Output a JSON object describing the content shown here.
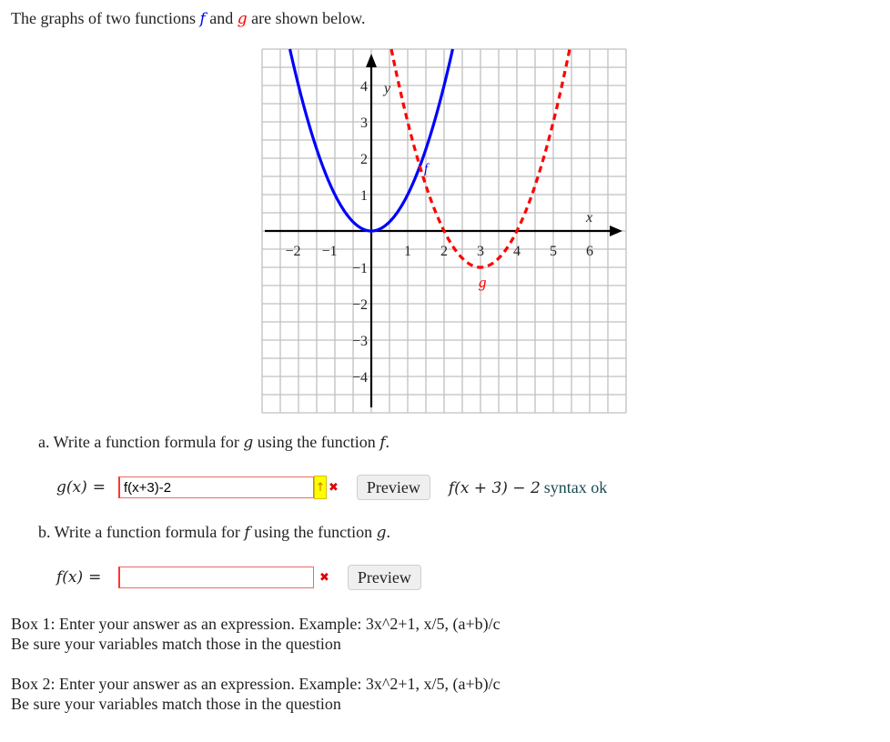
{
  "intro": {
    "before": "The graphs of two functions ",
    "f_symbol": "f",
    "middle": " and ",
    "g_symbol": "g",
    "after": " are shown below."
  },
  "colors": {
    "f": "#0000ff",
    "g": "#ff0000",
    "grid": "#c0c0c0",
    "axis": "#000000",
    "input_border": "#e86b6b",
    "syntax_ok": "#1a4a50"
  },
  "chart_data": {
    "type": "line",
    "title": "",
    "xlabel": "x",
    "ylabel": "y",
    "xlim": [
      -3,
      7
    ],
    "ylim": [
      -5,
      5
    ],
    "grid": true,
    "grid_minor_step": 0.5,
    "x_tick_labels": [
      "−2",
      "−1",
      "1",
      "2",
      "3",
      "4",
      "5",
      "6"
    ],
    "x_ticks": [
      -2,
      -1,
      1,
      2,
      3,
      4,
      5,
      6
    ],
    "y_tick_labels": [
      "4",
      "3",
      "2",
      "1",
      "−1",
      "−2",
      "−3",
      "−4"
    ],
    "y_ticks": [
      4,
      3,
      2,
      1,
      -1,
      -2,
      -3,
      -4
    ],
    "series": [
      {
        "name": "f",
        "label": "f",
        "style": "solid",
        "formula": "x^2",
        "vertex": [
          0,
          0
        ],
        "points": [
          [
            -2.236,
            5
          ],
          [
            -2,
            4
          ],
          [
            -1,
            1
          ],
          [
            0,
            0
          ],
          [
            1,
            1
          ],
          [
            2,
            4
          ],
          [
            2.236,
            5
          ]
        ]
      },
      {
        "name": "g",
        "label": "g",
        "style": "dashed",
        "formula": "(x-3)^2 - 1",
        "vertex": [
          3,
          -1
        ],
        "points": [
          [
            0.551,
            5
          ],
          [
            1,
            3
          ],
          [
            2,
            0
          ],
          [
            3,
            -1
          ],
          [
            4,
            0
          ],
          [
            5,
            3
          ],
          [
            5.449,
            5
          ]
        ]
      }
    ]
  },
  "question_a": {
    "prefix": "a. Write a function formula for ",
    "var1": "g",
    "middle": " using the function ",
    "var2": "f",
    "suffix": "."
  },
  "answer_a": {
    "label": "g(x)",
    "equals": "=",
    "value": "f(x+3)-2",
    "tip_icon": "↑",
    "status_icon": "✖",
    "preview_label": "Preview",
    "preview_math": "f(x + 3) − 2",
    "syntax_status": "syntax ok"
  },
  "question_b": {
    "prefix": "b. Write a function formula for ",
    "var1": "f",
    "middle": " using the function ",
    "var2": "g",
    "suffix": "."
  },
  "answer_b": {
    "label": "f(x)",
    "equals": "=",
    "value": "",
    "status_icon": "✖",
    "preview_label": "Preview"
  },
  "help": [
    {
      "line1": "Box 1: Enter your answer as an expression. Example: 3x^2+1, x/5, (a+b)/c",
      "line2": "Be sure your variables match those in the question"
    },
    {
      "line1": "Box 2: Enter your answer as an expression. Example: 3x^2+1, x/5, (a+b)/c",
      "line2": "Be sure your variables match those in the question"
    }
  ]
}
